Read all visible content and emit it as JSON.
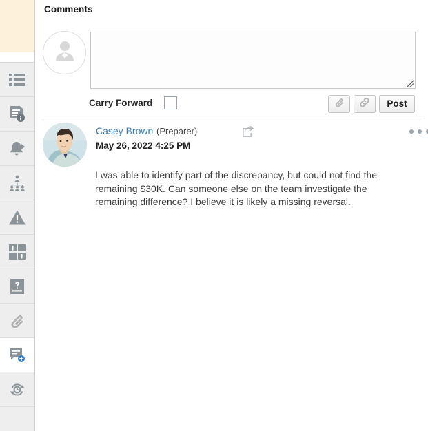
{
  "panel": {
    "title": "Comments"
  },
  "sidebar": {
    "items": [
      {
        "name": "list-view-icon",
        "label": "List"
      },
      {
        "name": "document-info-icon",
        "label": "Document Info"
      },
      {
        "name": "bell-icon",
        "label": "Alerts"
      },
      {
        "name": "org-chart-icon",
        "label": "Team"
      },
      {
        "name": "warning-icon",
        "label": "Warnings"
      },
      {
        "name": "dashboard-tiles-icon",
        "label": "Dashboard"
      },
      {
        "name": "question-box-icon",
        "label": "Questions"
      },
      {
        "name": "paperclip-icon",
        "label": "Attachments"
      },
      {
        "name": "comment-add-icon",
        "label": "Comments"
      },
      {
        "name": "history-refresh-icon",
        "label": "History"
      }
    ]
  },
  "composer": {
    "avatar_name": "default-user-avatar",
    "textarea_value": "",
    "textarea_placeholder": "",
    "carry_forward_label": "Carry Forward",
    "carry_forward_checked": false,
    "attach_icon": "paperclip-icon",
    "link_icon": "link-icon",
    "post_label": "Post"
  },
  "comment": {
    "author": "Casey Brown",
    "role": "(Preparer)",
    "share_icon": "share-icon",
    "timestamp": "May 26, 2022 4:25 PM",
    "more_icon": "more-options-icon",
    "body": "I was able to identify part of the discrepancy, but could not find the remaining $30K. Can someone else on the team investigate the remaining difference? I believe it is likely a missing reversal."
  },
  "colors": {
    "link": "#3d7fb5",
    "sidebar_bg": "#eeeeee",
    "highlight_cream": "#fdf1dc",
    "icon_gray": "#8d8d8d"
  }
}
